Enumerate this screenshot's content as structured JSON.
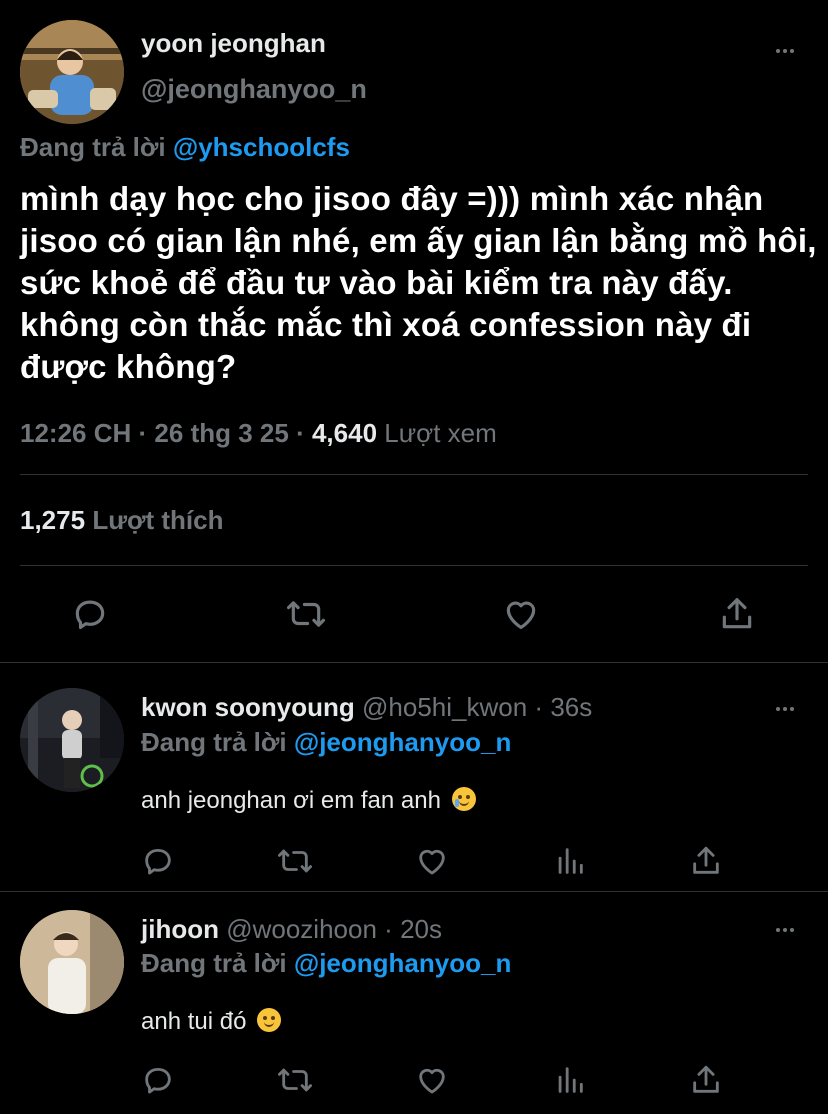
{
  "main_tweet": {
    "author_name": "yoon jeonghan",
    "author_handle": "@jeonghanyoo_n",
    "replying_prefix": "Đang trả lời",
    "replying_to": "@yhschoolcfs",
    "text": "mình dạy học cho jisoo đây =))) mình xác nhận jisoo có gian lận nhé, em ấy gian lận bằng mồ hôi, sức khoẻ để đầu tư vào bài kiểm tra này đấy. không còn thắc mắc thì xoá confession này đi được không?",
    "time": "12:26 CH",
    "date": "26 thg 3 25",
    "separator": "·",
    "views_count": "4,640",
    "views_label": "Lượt xem",
    "likes_count": "1,275",
    "likes_label": "Lượt thích",
    "actions": [
      "reply-icon",
      "retweet-icon",
      "like-icon",
      "share-icon"
    ]
  },
  "replies": [
    {
      "author_name": "kwon soonyoung",
      "author_handle": "@ho5hi_kwon",
      "time": "36s",
      "separator": "·",
      "replying_prefix": "Đang trả lời",
      "replying_to": "@jeonghanyoo_n",
      "text": "anh jeonghan ơi em fan anh",
      "emoji": "loudly-crying-face-emoji",
      "actions": [
        "reply-icon",
        "retweet-icon",
        "like-icon",
        "stats-icon",
        "share-icon"
      ]
    },
    {
      "author_name": "jihoon",
      "author_handle": "@woozihoon",
      "time": "20s",
      "separator": "·",
      "replying_prefix": "Đang trả lời",
      "replying_to": "@jeonghanyoo_n",
      "text": "anh tui đó",
      "emoji": "savoring-face-emoji",
      "actions": [
        "reply-icon",
        "retweet-icon",
        "like-icon",
        "stats-icon",
        "share-icon"
      ]
    }
  ],
  "colors": {
    "background": "#000000",
    "text": "#e7e9ea",
    "muted": "#71767b",
    "accent": "#1d9bf0",
    "divider": "#2f3336"
  }
}
